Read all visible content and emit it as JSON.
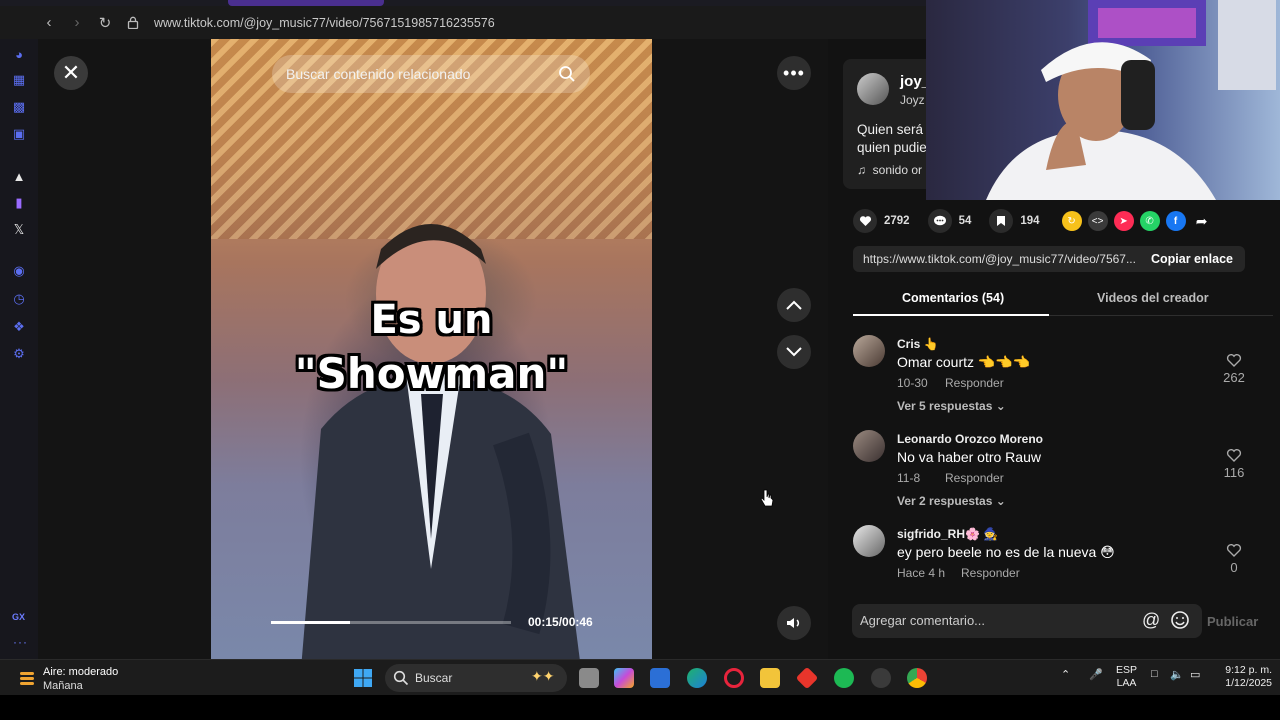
{
  "browser": {
    "url": "www.tiktok.com/@joy_music77/video/7567151985716235576"
  },
  "video": {
    "search_placeholder": "Buscar contenido relacionado",
    "caption_line1": "Es un",
    "caption_line2": "\"Showman\"",
    "time": "00:15/00:46",
    "progress_fraction": 0.33
  },
  "creator": {
    "username": "joy_",
    "nickname": "Joyz",
    "description_line1": "Quien será",
    "description_line2": "quien pudie",
    "music": "sonido or"
  },
  "actions": {
    "likes": "2792",
    "comments": "54",
    "saves": "194"
  },
  "share": {
    "link": "https://www.tiktok.com/@joy_music77/video/7567...",
    "copy_label": "Copiar enlace"
  },
  "tabs": {
    "comments": "Comentarios (54)",
    "videos": "Videos del creador"
  },
  "comments": [
    {
      "name": "Cris 👆",
      "text": "Omar courtz 👈👈👈",
      "date": "10-30",
      "reply": "Responder",
      "more": "Ver 5 respuestas ⌄",
      "likes": "262"
    },
    {
      "name": "Leonardo Orozco Moreno",
      "text": "No va haber otro Rauw",
      "date": "11-8",
      "reply": "Responder",
      "more": "Ver 2 respuestas ⌄",
      "likes": "116"
    },
    {
      "name": "sigfrido_RH🌸 🧙",
      "text": "ey pero beele no es de la nueva 😳",
      "date": "Hace 4 h",
      "reply": "Responder",
      "likes": "0"
    }
  ],
  "composer": {
    "placeholder": "Agregar comentario...",
    "publish": "Publicar"
  },
  "sidebar": {
    "gx_label": "GX",
    "more": "···"
  },
  "taskbar": {
    "weather_line1": "Aire: moderado",
    "weather_line2": "Mañana",
    "search": "Buscar",
    "lang1": "ESP",
    "lang2": "LAA",
    "time": "9:12 p. m.",
    "date": "1/12/2025"
  },
  "colors": {
    "accent": "#fe2c55",
    "sidebar_icon": "#5b6ef0"
  }
}
